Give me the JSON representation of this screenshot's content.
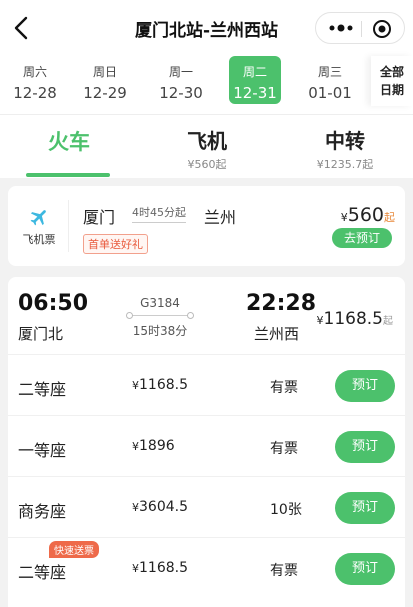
{
  "header": {
    "title": "厦门北站-兰州西站"
  },
  "dates": [
    {
      "week": "周六",
      "date": "12-28",
      "active": false
    },
    {
      "week": "周日",
      "date": "12-29",
      "active": false
    },
    {
      "week": "周一",
      "date": "12-30",
      "active": false
    },
    {
      "week": "周二",
      "date": "12-31",
      "active": true
    },
    {
      "week": "周三",
      "date": "01-01",
      "active": false
    }
  ],
  "all_dates": {
    "line1": "全部",
    "line2": "日期"
  },
  "mode_tabs": [
    {
      "label": "火车",
      "sub": ""
    },
    {
      "label": "飞机",
      "sub": "¥560起"
    },
    {
      "label": "中转",
      "sub": "¥1235.7起"
    }
  ],
  "flight": {
    "label": "飞机票",
    "from": "厦门",
    "duration": "4时45分起",
    "to": "兰州",
    "gift": "首单送好礼",
    "currency": "¥",
    "price": "560",
    "price_suffix": "起",
    "book_label": "去预订"
  },
  "train": {
    "dep_time": "06:50",
    "dep_station": "厦门北",
    "train_no": "G3184",
    "duration": "15时38分",
    "arr_time": "22:28",
    "arr_station": "兰州西",
    "currency": "¥",
    "price": "1168.5",
    "price_suffix": "起",
    "seats": [
      {
        "name": "二等座",
        "price": "1168.5",
        "avail": "有票",
        "book": "预订",
        "tag": ""
      },
      {
        "name": "一等座",
        "price": "1896",
        "avail": "有票",
        "book": "预订",
        "tag": ""
      },
      {
        "name": "商务座",
        "price": "3604.5",
        "avail": "10张",
        "book": "预订",
        "tag": ""
      },
      {
        "name": "二等座",
        "price": "1168.5",
        "avail": "有票",
        "book": "预订",
        "tag": "快速送票"
      }
    ]
  },
  "colors": {
    "accent": "#4cc16c",
    "tag": "#ee6a4a"
  },
  "icons": [
    "back-arrow-icon",
    "more-dots-icon",
    "close-target-icon",
    "plane-icon"
  ]
}
